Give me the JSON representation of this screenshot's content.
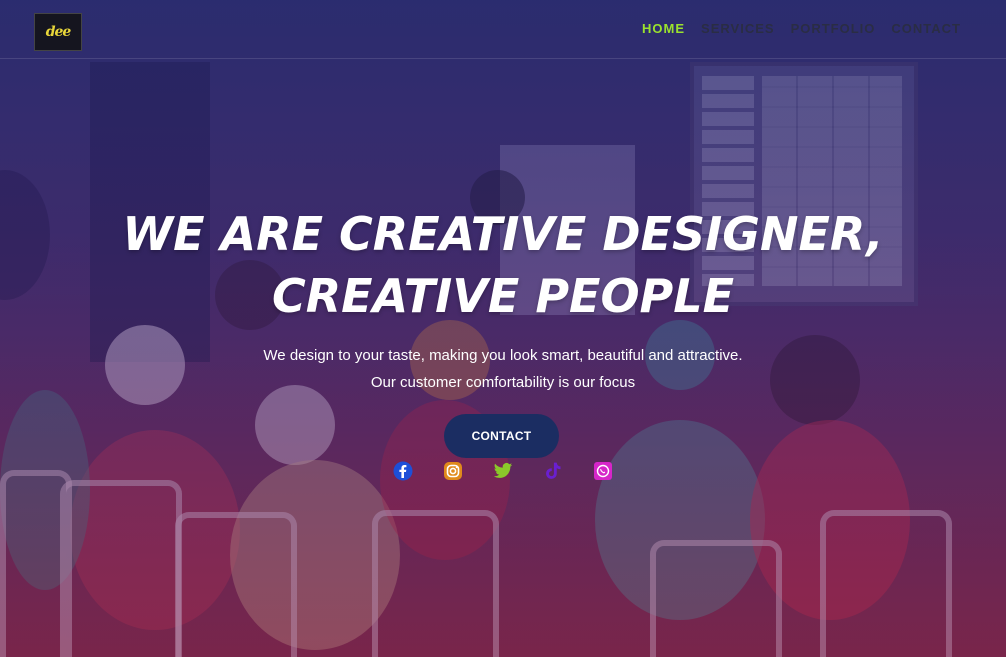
{
  "logo": {
    "text": "dee"
  },
  "nav": {
    "items": [
      {
        "label": "HOME",
        "active": true
      },
      {
        "label": "SERVICES"
      },
      {
        "label": "PORTFOLIO"
      },
      {
        "label": "CONTACT"
      }
    ]
  },
  "hero": {
    "headline_line1": "WE ARE CREATIVE DESIGNER,",
    "headline_line2": "CREATIVE PEOPLE",
    "subtitle_line1": "We design to your taste, making you look smart, beautiful and attractive.",
    "subtitle_line2": "Our customer comfortability is our focus",
    "cta_label": "CONTACT"
  },
  "social": [
    {
      "icon": "facebook-icon",
      "color": "#1d4fd8"
    },
    {
      "icon": "instagram-icon",
      "color": "#e08a1c"
    },
    {
      "icon": "twitter-icon",
      "color": "#8bc82a"
    },
    {
      "icon": "tiktok-icon",
      "color": "#6a1fd0"
    },
    {
      "icon": "whatsapp-icon",
      "color": "#d626c9"
    }
  ],
  "colors": {
    "nav_active": "#9be22d",
    "nav_default": "#2a2d44",
    "cta_background": "#1b2d62"
  }
}
